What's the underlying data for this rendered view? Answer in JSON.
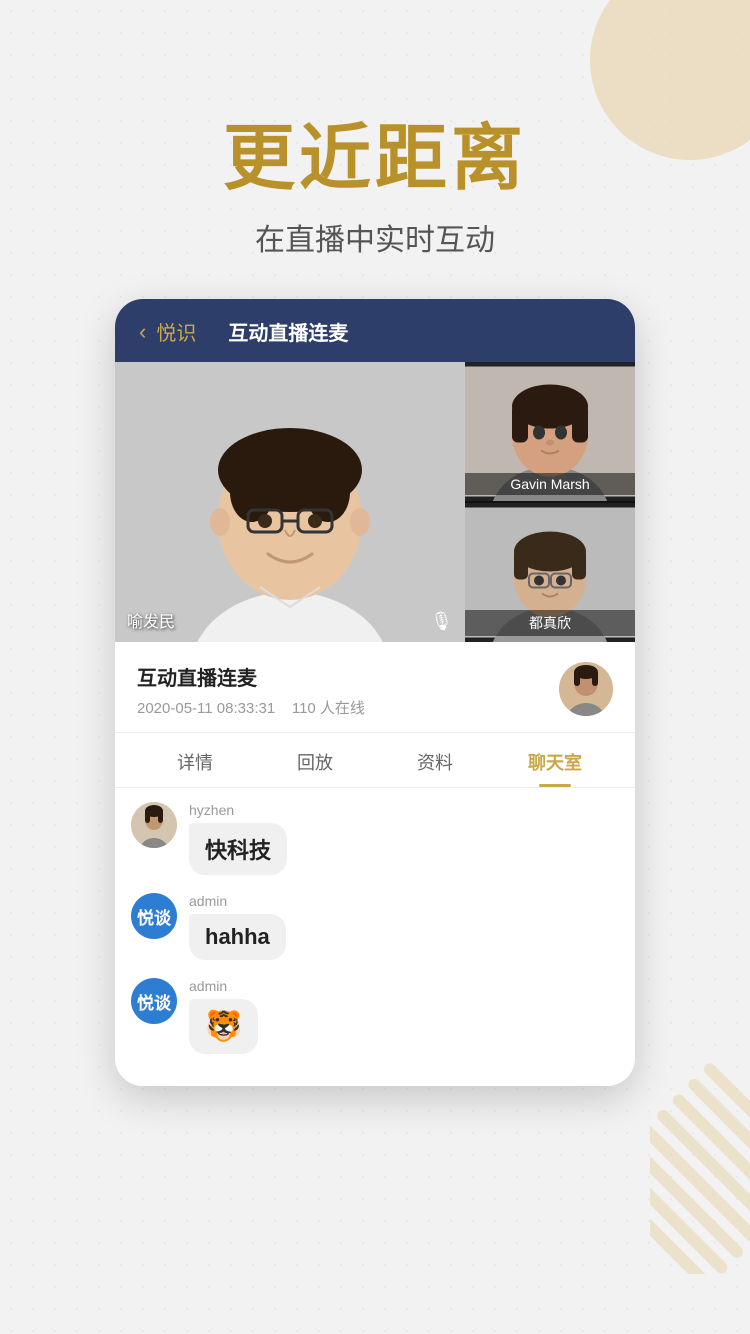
{
  "background": {
    "color": "#f2f2f2",
    "accent_color": "#e8d5b0"
  },
  "hero": {
    "title": "更近距离",
    "subtitle": "在直播中实时互动"
  },
  "phone": {
    "header": {
      "back_label": "悦识",
      "title": "互动直播连麦"
    },
    "video": {
      "main_person": {
        "name": "喻发民",
        "has_mic": true
      },
      "side_persons": [
        {
          "name": "Gavin Marsh"
        },
        {
          "name": "都真欣"
        }
      ]
    },
    "info": {
      "title": "互动直播连麦",
      "date": "2020-05-11 08:33:31",
      "online": "110 人在线"
    },
    "tabs": [
      {
        "label": "详情",
        "active": false
      },
      {
        "label": "回放",
        "active": false
      },
      {
        "label": "资料",
        "active": false
      },
      {
        "label": "聊天室",
        "active": true
      }
    ],
    "chat": {
      "messages": [
        {
          "avatar_type": "photo",
          "username": "hyzhen",
          "content": "快科技",
          "is_emoji": false
        },
        {
          "avatar_type": "brand",
          "brand_text": "悦谈",
          "username": "admin",
          "content": "hahha",
          "is_emoji": false
        },
        {
          "avatar_type": "brand",
          "brand_text": "悦谈",
          "username": "admin",
          "content": "🐯",
          "is_emoji": true
        }
      ]
    }
  }
}
